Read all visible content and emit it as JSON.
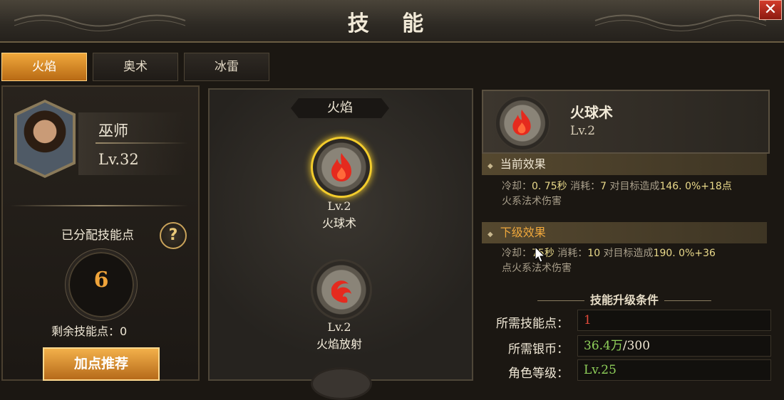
{
  "window": {
    "title": "技 能",
    "close_label": "✕"
  },
  "tabs": [
    {
      "label": "火焰",
      "active": true
    },
    {
      "label": "奥术",
      "active": false
    },
    {
      "label": "冰雷",
      "active": false
    }
  ],
  "character": {
    "class_name": "巫师",
    "level": "Lv.32"
  },
  "points": {
    "allocated_label": "已分配技能点",
    "help_label": "?",
    "allocated_value": "6",
    "remaining_label": "剩余技能点：0",
    "recommend_button": "加点推荐"
  },
  "tree": {
    "header": "火焰",
    "skills": [
      {
        "level": "Lv.2",
        "name": "火球术",
        "icon": "fire-icon",
        "selected": true
      },
      {
        "level": "Lv.2",
        "name": "火焰放射",
        "icon": "flame-spray-icon",
        "selected": false
      }
    ]
  },
  "detail": {
    "name": "火球术",
    "level": "Lv.2",
    "current": {
      "title": "当前效果",
      "cooldown_label": "冷却：",
      "cooldown": "0. 75秒",
      "cost_label": "消耗：",
      "cost": "7",
      "damage_prefix": "对目标造成",
      "damage": "146. 0%+18点",
      "tail": "火系法术伤害"
    },
    "next": {
      "title": "下级效果",
      "cooldown_label": "冷却：",
      "cooldown": "75秒",
      "cost_label": "消耗：",
      "cost": "10",
      "damage_prefix": "对目标造成",
      "damage": "190. 0%+36",
      "tail": "点火系法术伤害"
    },
    "requirements": {
      "title": "技能升级条件",
      "skill_points_label": "所需技能点：",
      "skill_points_value": "1",
      "silver_label": "所需银币：",
      "silver_have": "36.4万",
      "silver_need": "/300",
      "role_level_label": "角色等级：",
      "role_level_value": "Lv.25"
    }
  },
  "colors": {
    "accent_orange": "#f0a83c",
    "selected_ring": "#f3cc2c",
    "requirement_unmet": "#e34a3a",
    "requirement_met": "#8fd05a",
    "fire": "#e52a1e"
  }
}
